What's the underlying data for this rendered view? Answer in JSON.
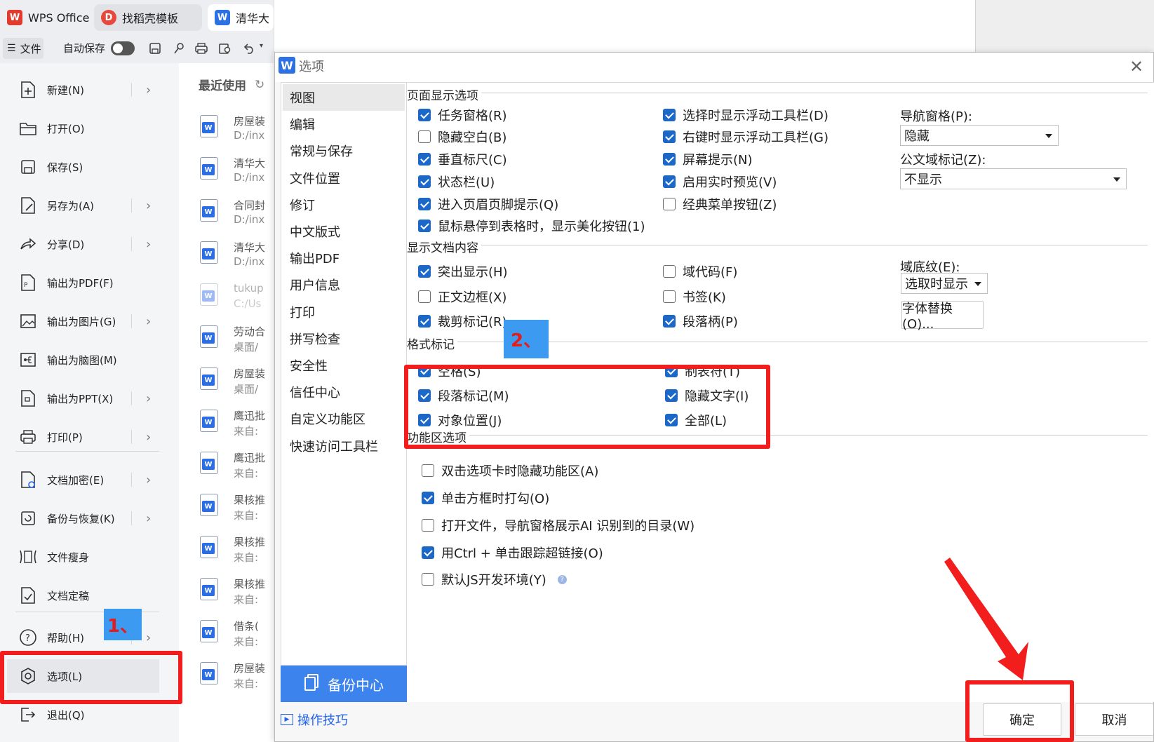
{
  "tabs": [
    {
      "label": "WPS Office",
      "logo": "W"
    },
    {
      "label": "找稻壳模板",
      "logo": "D"
    },
    {
      "label": "清华大",
      "logo": "W"
    }
  ],
  "toolbar": {
    "file_label": "文件",
    "autosave_label": "自动保存"
  },
  "menu": [
    {
      "label": "新建(N)",
      "icon": "new-icon",
      "arrow": true
    },
    {
      "label": "打开(O)",
      "icon": "folder-icon",
      "arrow": false
    },
    {
      "label": "保存(S)",
      "icon": "save-icon",
      "arrow": false
    },
    {
      "label": "另存为(A)",
      "icon": "save-as-icon",
      "arrow": true
    },
    {
      "label": "分享(D)",
      "icon": "share-icon",
      "arrow": true
    },
    {
      "label": "输出为PDF(F)",
      "icon": "pdf-icon",
      "arrow": false
    },
    {
      "label": "输出为图片(G)",
      "icon": "image-icon",
      "arrow": true
    },
    {
      "label": "输出为脑图(M)",
      "icon": "mindmap-icon",
      "arrow": false
    },
    {
      "label": "输出为PPT(X)",
      "icon": "ppt-icon",
      "arrow": true
    },
    {
      "label": "打印(P)",
      "icon": "print-icon",
      "arrow": true
    },
    {
      "label": "文档加密(E)",
      "icon": "lock-icon",
      "arrow": true
    },
    {
      "label": "备份与恢复(K)",
      "icon": "backup-icon",
      "arrow": true
    },
    {
      "label": "文件瘦身",
      "icon": "slim-icon",
      "arrow": false
    },
    {
      "label": "文档定稿",
      "icon": "finalize-icon",
      "arrow": false
    },
    {
      "label": "帮助(H)",
      "icon": "help-icon",
      "arrow": true
    },
    {
      "label": "选项(L)",
      "icon": "gear-icon",
      "arrow": false
    },
    {
      "label": "退出(Q)",
      "icon": "exit-icon",
      "arrow": false
    }
  ],
  "recent": {
    "title": "最近使用",
    "items": [
      {
        "name": "房屋装",
        "path": "D:/inx"
      },
      {
        "name": "清华大",
        "path": "D:/inx"
      },
      {
        "name": "合同封",
        "path": "D:/inx"
      },
      {
        "name": "清华大",
        "path": "D:/inx"
      },
      {
        "name": "tukup",
        "path": "C:/Us"
      },
      {
        "name": "劳动合",
        "path": "桌面/"
      },
      {
        "name": "房屋装",
        "path": "桌面/"
      },
      {
        "name": "鹰迅批",
        "path": "来自:"
      },
      {
        "name": "鹰迅批",
        "path": "来自:"
      },
      {
        "name": "果核推",
        "path": "来自:"
      },
      {
        "name": "果核推",
        "path": "来自:"
      },
      {
        "name": "果核推",
        "path": "来自:"
      },
      {
        "name": "借条(",
        "path": "来自:"
      },
      {
        "name": "房屋装",
        "path": "来自:"
      }
    ]
  },
  "dialog": {
    "title": "选项",
    "logo": "W",
    "nav": [
      "视图",
      "编辑",
      "常规与保存",
      "文件位置",
      "修订",
      "中文版式",
      "输出PDF",
      "用户信息",
      "打印",
      "拼写检查",
      "安全性",
      "信任中心",
      "自定义功能区",
      "快速访问工具栏"
    ],
    "backup_label": "备份中心",
    "tips_label": "操作技巧",
    "ok_label": "确定",
    "cancel_label": "取消",
    "sections": {
      "page_display": "页面显示选项",
      "doc_content": "显示文档内容",
      "format_marks": "格式标记",
      "ribbon": "功能区选项"
    },
    "page_display_left": [
      {
        "label": "任务窗格(R)",
        "checked": true
      },
      {
        "label": "隐藏空白(B)",
        "checked": false
      },
      {
        "label": "垂直标尺(C)",
        "checked": true
      },
      {
        "label": "状态栏(U)",
        "checked": true
      },
      {
        "label": "进入页眉页脚提示(Q)",
        "checked": true
      },
      {
        "label": "鼠标悬停到表格时，显示美化按钮(1)",
        "checked": true
      }
    ],
    "page_display_mid": [
      {
        "label": "选择时显示浮动工具栏(D)",
        "checked": true
      },
      {
        "label": "右键时显示浮动工具栏(G)",
        "checked": true
      },
      {
        "label": "屏幕提示(N)",
        "checked": true
      },
      {
        "label": "启用实时预览(V)",
        "checked": true
      },
      {
        "label": "经典菜单按钮(Z)",
        "checked": false
      }
    ],
    "nav_pane_label": "导航窗格(P):",
    "nav_pane_value": "隐藏",
    "field_mark_label": "公文域标记(Z):",
    "field_mark_value": "不显示",
    "doc_content_left": [
      {
        "label": "突出显示(H)",
        "checked": true
      },
      {
        "label": "正文边框(X)",
        "checked": false
      },
      {
        "label": "裁剪标记(R)",
        "checked": true
      }
    ],
    "doc_content_mid": [
      {
        "label": "域代码(F)",
        "checked": false
      },
      {
        "label": "书签(K)",
        "checked": false
      },
      {
        "label": "段落柄(P)",
        "checked": true
      }
    ],
    "field_shading_label": "域底纹(E):",
    "field_shading_value": "选取时显示",
    "font_replace_label": "字体替换(O)...",
    "format_left": [
      {
        "label": "空格(S)",
        "checked": true
      },
      {
        "label": "段落标记(M)",
        "checked": true
      },
      {
        "label": "对象位置(J)",
        "checked": true
      }
    ],
    "format_mid": [
      {
        "label": "制表符(T)",
        "checked": true
      },
      {
        "label": "隐藏文字(I)",
        "checked": true
      },
      {
        "label": "全部(L)",
        "checked": true
      }
    ],
    "ribbon_options": [
      {
        "label": "双击选项卡时隐藏功能区(A)",
        "checked": false
      },
      {
        "label": "单击方框时打勾(O)",
        "checked": true
      },
      {
        "label": "打开文件，导航窗格展示AI 识别到的目录(W)",
        "checked": false
      },
      {
        "label": "用Ctrl + 单击跟踪超链接(O)",
        "checked": true
      },
      {
        "label": "默认JS开发环境(Y)",
        "checked": false,
        "help": "?"
      }
    ]
  },
  "annotations": {
    "step1": "1、",
    "step2": "2、"
  },
  "colors": {
    "accent": "#1b68c9",
    "annotation_red": "#f21d1d",
    "badge_blue": "#3c9bf0"
  }
}
